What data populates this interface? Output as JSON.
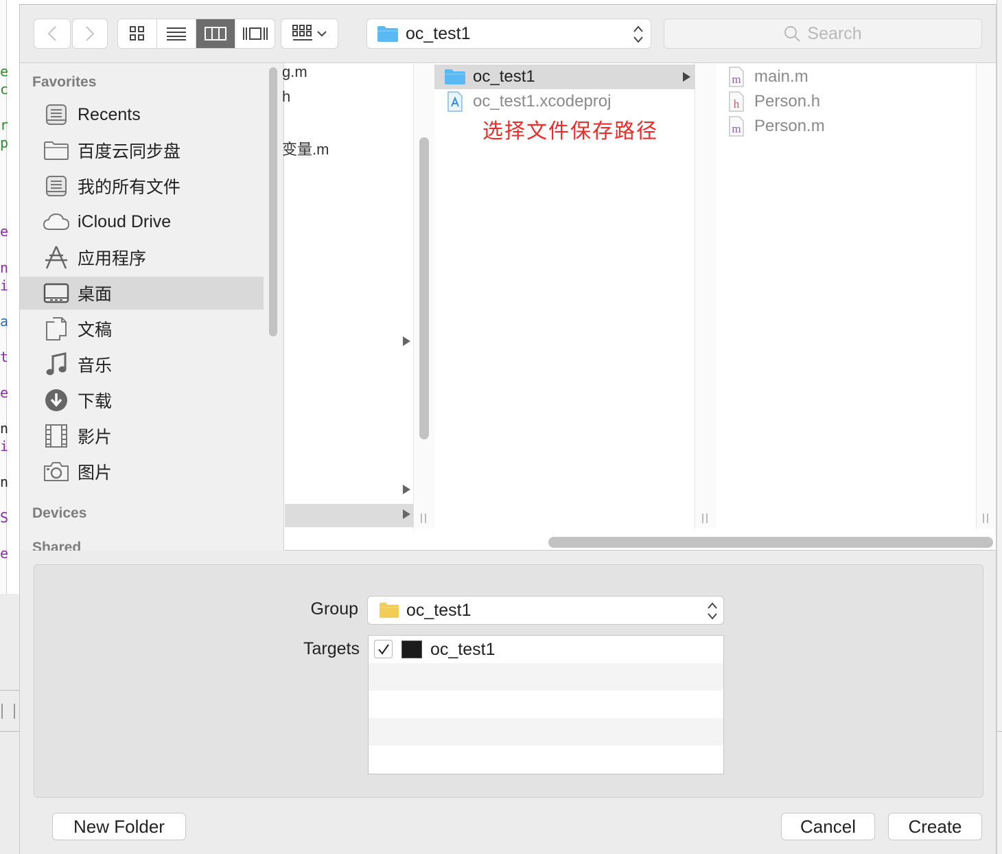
{
  "toolbar": {
    "path_label": "oc_test1",
    "search_placeholder": "Search"
  },
  "sidebar": {
    "favorites_header": "Favorites",
    "favorites": [
      {
        "label": "Recents",
        "icon": "recents-icon"
      },
      {
        "label": "百度云同步盘",
        "icon": "folder-icon"
      },
      {
        "label": "我的所有文件",
        "icon": "all-files-icon"
      },
      {
        "label": "iCloud Drive",
        "icon": "cloud-icon"
      },
      {
        "label": "应用程序",
        "icon": "applications-icon"
      },
      {
        "label": "桌面",
        "icon": "desktop-icon"
      },
      {
        "label": "文稿",
        "icon": "documents-icon"
      },
      {
        "label": "音乐",
        "icon": "music-icon"
      },
      {
        "label": "下载",
        "icon": "download-icon"
      },
      {
        "label": "影片",
        "icon": "movies-icon"
      },
      {
        "label": "图片",
        "icon": "camera-icon"
      }
    ],
    "devices_header": "Devices",
    "shared_header_partial": "Shared"
  },
  "column1": {
    "fragments": [
      "g.m",
      "h",
      "变量.m"
    ]
  },
  "column2": {
    "items": [
      {
        "label": "oc_test1",
        "icon": "folder-icon"
      },
      {
        "label": "oc_test1.xcodeproj",
        "icon": "xcodeproj-icon"
      }
    ],
    "annotation": "选择文件保存路径"
  },
  "column3": {
    "items": [
      {
        "label": "main.m",
        "badge": "m"
      },
      {
        "label": "Person.h",
        "badge": "h"
      },
      {
        "label": "Person.m",
        "badge": "m"
      }
    ]
  },
  "options": {
    "group_label": "Group",
    "group_value": "oc_test1",
    "targets_label": "Targets",
    "targets": [
      {
        "name": "oc_test1",
        "checked": true
      }
    ]
  },
  "buttons": {
    "new_folder": "New Folder",
    "cancel": "Cancel",
    "create": "Create"
  },
  "colors": {
    "annotation": "#ee2b2b",
    "folder_blue": "#5ab8f2",
    "folder_yellow": "#f2cc55",
    "selection": "#d9d9d9"
  }
}
